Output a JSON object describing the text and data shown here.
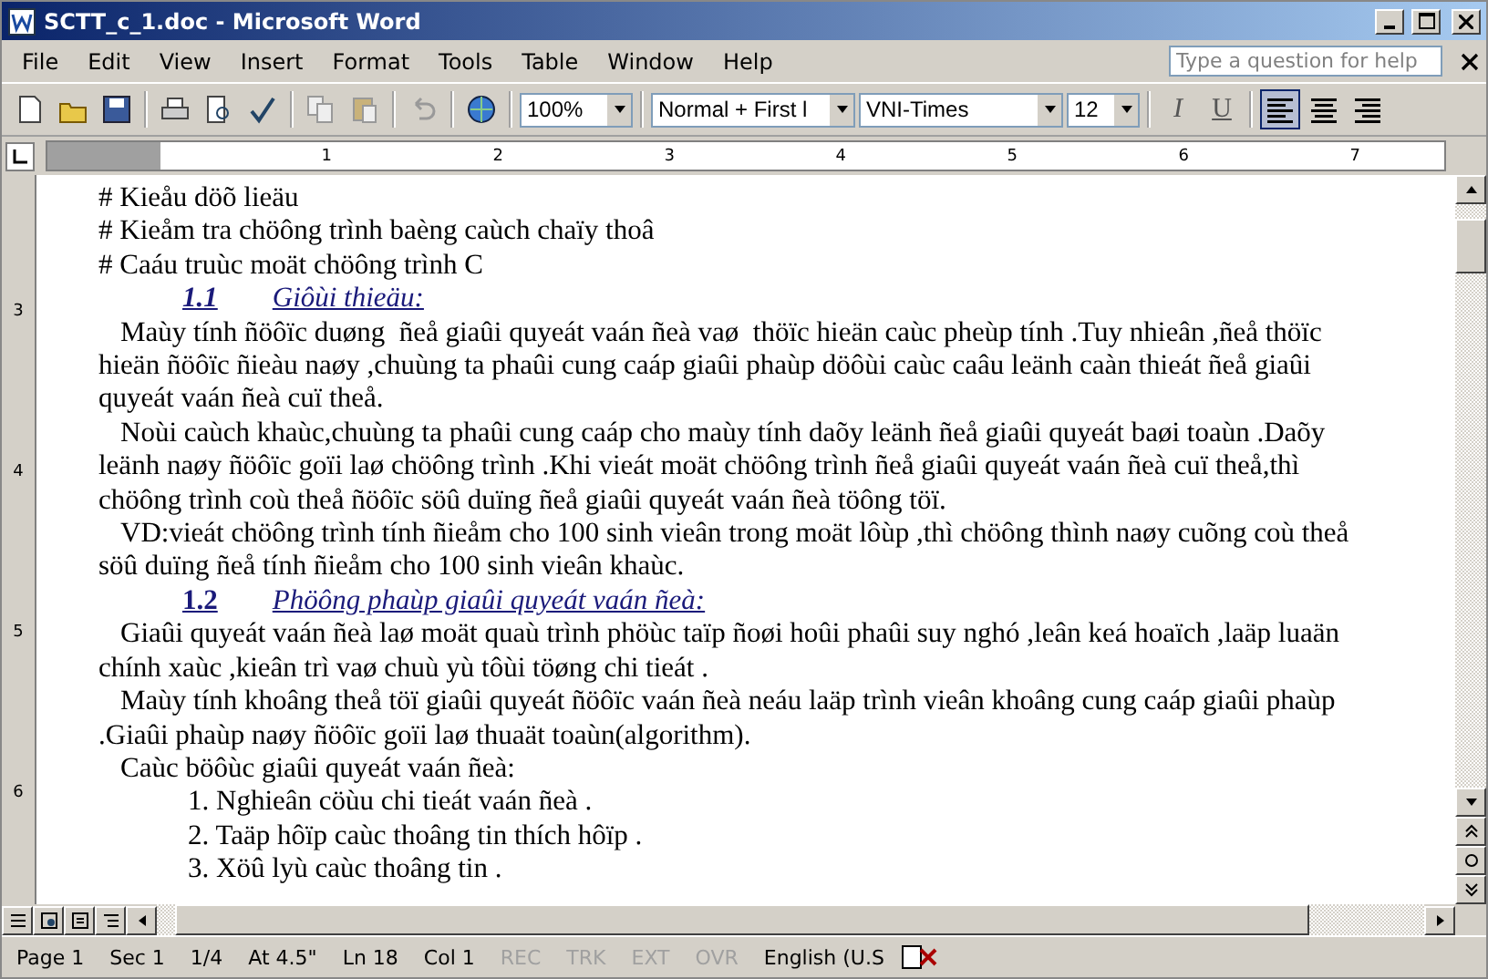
{
  "window": {
    "title": "SCTT_c_1.doc - Microsoft Word"
  },
  "menu": {
    "items": [
      "File",
      "Edit",
      "View",
      "Insert",
      "Format",
      "Tools",
      "Table",
      "Window",
      "Help"
    ],
    "help_field": {
      "placeholder": "Type a question for help"
    }
  },
  "toolbar": {
    "zoom": "100%",
    "style": "Normal + First l",
    "font": "VNI-Times",
    "size": "12",
    "italic": "I",
    "underline": "U",
    "align_buttons": [
      {
        "kind": "left",
        "selected": true
      },
      {
        "kind": "center",
        "selected": false
      },
      {
        "kind": "right",
        "selected": false
      }
    ]
  },
  "ruler": {
    "numbers": [
      "1",
      "2",
      "3",
      "4",
      "5",
      "6",
      "7"
    ],
    "vertical_numbers": [
      "3",
      "4",
      "5",
      "6"
    ]
  },
  "document": {
    "lines": [
      {
        "kind": "plain",
        "text": "# Kieåu döõ lieäu"
      },
      {
        "kind": "plain",
        "text": "# Kieåm tra chöông trình baèng caùch chaïy thoâ"
      },
      {
        "kind": "plain",
        "text": "# Caáu truùc moät chöông trình C"
      },
      {
        "kind": "heading",
        "number": "1.1",
        "text": "Giôùi thieäu:",
        "italic": true
      },
      {
        "kind": "first",
        "text": "Maùy tính ñöôïc duøng  ñeå giaûi quyeát vaán ñeà vaø  thöïc hieän caùc pheùp tính .Tuy nhieân ,ñeå thöïc"
      },
      {
        "kind": "plain",
        "text": "hieän ñöôïc ñieàu naøy ,chuùng ta phaûi cung caáp giaûi phaùp döôùi caùc caâu leänh caàn thieát ñeå giaûi"
      },
      {
        "kind": "plain",
        "text": "quyeát vaán ñeà cuï theå."
      },
      {
        "kind": "first",
        "text": "Noùi caùch khaùc,chuùng ta phaûi cung caáp cho maùy tính daõy leänh ñeå giaûi quyeát baøi toaùn .Daõy"
      },
      {
        "kind": "plain",
        "text": "leänh naøy ñöôïc goïi laø chöông trình .Khi vieát moät chöông trình ñeå giaûi quyeát vaán ñeà cuï theå,thì"
      },
      {
        "kind": "plain",
        "text": "chöông trình coù theå ñöôïc söû duïng ñeå giaûi quyeát vaán ñeà töông töï."
      },
      {
        "kind": "first",
        "text": "VD:vieát chöông trình tính ñieåm cho 100 sinh vieân trong moät lôùp ,thì chöông thình naøy cuõng coù theå"
      },
      {
        "kind": "plain",
        "text": "söû duïng ñeå tính ñieåm cho 100 sinh vieân khaùc."
      },
      {
        "kind": "heading",
        "number": "1.2",
        "text": "Phöông phaùp giaûi quyeát vaán ñeà:",
        "italic": false
      },
      {
        "kind": "first",
        "text": "Giaûi quyeát vaán ñeà laø moät quaù trình phöùc taïp ñoøi hoûi phaûi suy nghó ,leân keá hoaïch ,laäp luaän"
      },
      {
        "kind": "plain",
        "text": "chính xaùc ,kieân trì vaø chuù yù tôùi töøng chi tieát ."
      },
      {
        "kind": "first",
        "text": "Maùy tính khoâng theå töï giaûi quyeát ñöôïc vaán ñeà neáu laäp trình vieân khoâng cung caáp giaûi phaùp"
      },
      {
        "kind": "plain",
        "text": ".Giaûi phaùp naøy ñöôïc goïi laø thuaät toaùn(algorithm)."
      },
      {
        "kind": "first",
        "text": "Caùc böôùc giaûi quyeát vaán ñeà:"
      },
      {
        "kind": "item",
        "text": "1. Nghieân cöùu chi tieát vaán ñeà ."
      },
      {
        "kind": "item",
        "text": "2. Taäp hôïp caùc thoâng tin thích hôïp ."
      },
      {
        "kind": "item",
        "text": "3. Xöû lyù caùc thoâng tin ."
      }
    ]
  },
  "status_bar": {
    "items": [
      {
        "text": "Page 1",
        "disabled": false
      },
      {
        "text": "Sec 1",
        "disabled": false
      },
      {
        "text": "1/4",
        "disabled": false
      },
      {
        "text": "At 4.5\"",
        "disabled": false
      },
      {
        "text": "Ln 18",
        "disabled": false
      },
      {
        "text": "Col 1",
        "disabled": false
      },
      {
        "text": "REC",
        "disabled": true
      },
      {
        "text": "TRK",
        "disabled": true
      },
      {
        "text": "EXT",
        "disabled": true
      },
      {
        "text": "OVR",
        "disabled": true
      },
      {
        "text": "English (U.S",
        "disabled": false
      }
    ]
  }
}
